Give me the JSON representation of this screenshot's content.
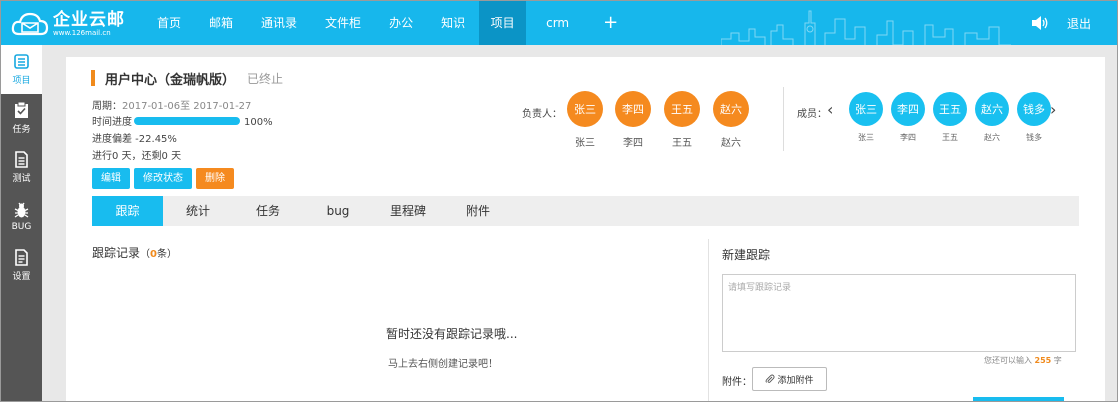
{
  "app": {
    "name": "企业云邮",
    "url": "www.126mail.cn"
  },
  "nav": [
    "首页",
    "邮箱",
    "通讯录",
    "文件柜",
    "办公",
    "知识",
    "项目",
    "crm",
    "+"
  ],
  "nav_active": 6,
  "top_right": {
    "logout": "退出"
  },
  "sidebar": [
    {
      "label": "项目",
      "icon": "project-icon",
      "active": true
    },
    {
      "label": "任务",
      "icon": "task-clipboard-icon",
      "active": false
    },
    {
      "label": "测试",
      "icon": "test-document-icon",
      "active": false
    },
    {
      "label": "BUG",
      "icon": "bug-icon",
      "active": false
    },
    {
      "label": "设置",
      "icon": "settings-document-icon",
      "active": false
    }
  ],
  "project": {
    "title": "用户中心（金瑞帆版）",
    "status": "已终止",
    "period_label": "周期：",
    "period_value": "2017-01-06至 2017-01-27",
    "progress_label": "时间进度",
    "progress_value": "100%",
    "progress_fraction": 1.0,
    "deviation": "进度偏差 -22.45%",
    "days": "进行0 天，还剩0 天"
  },
  "buttons": {
    "edit": "编辑",
    "change_status": "修改状态",
    "delete": "删除"
  },
  "owners": {
    "label": "负责人：",
    "people": [
      "张三",
      "李四",
      "王五",
      "赵六"
    ]
  },
  "members": {
    "label": "成员：",
    "people": [
      "张三",
      "李四",
      "王五",
      "赵六",
      "钱多"
    ]
  },
  "tabs": [
    "跟踪",
    "统计",
    "任务",
    "bug",
    "里程碑",
    "附件"
  ],
  "tab_active": 0,
  "tracking": {
    "title": "跟踪记录",
    "count_open": "（",
    "count": "0",
    "count_close": "条）",
    "empty_title": "暂时还没有跟踪记录哦...",
    "empty_sub": "马上去右侧创建记录吧！"
  },
  "new_tracking": {
    "title": "新建跟踪",
    "placeholder": "请填写跟踪记录",
    "hint_prefix": "您还可以输入",
    "hint_count": "255",
    "hint_suffix": "字",
    "attach_label": "附件：",
    "attach_button": "添加附件"
  },
  "colors": {
    "accent": "#17b7ec",
    "orange": "#f58a1f",
    "sidebar": "#555555"
  }
}
